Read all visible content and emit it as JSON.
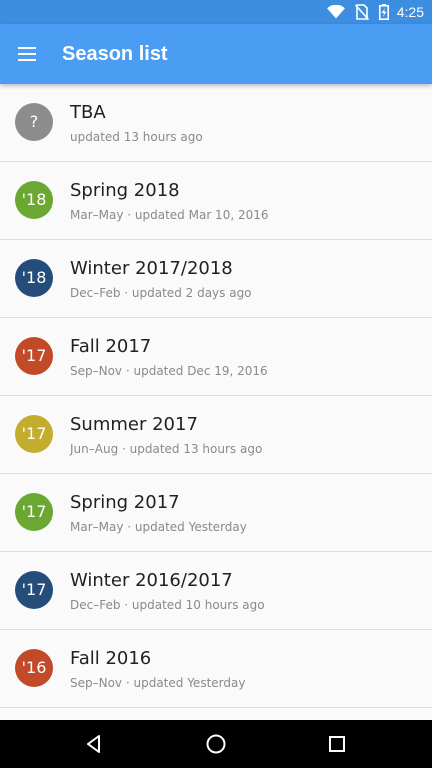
{
  "status_bar": {
    "time": "4:25",
    "icons": [
      "wifi-icon",
      "no-sim-icon",
      "battery-charging-icon"
    ]
  },
  "app_bar": {
    "title": "Season list",
    "menu_icon": "menu-icon"
  },
  "seasons": [
    {
      "badge": "?",
      "color": "#8c8c8c",
      "title": "TBA",
      "subtitle": "updated 13 hours ago"
    },
    {
      "badge": "'18",
      "color": "#6aa832",
      "title": "Spring 2018",
      "subtitle": "Mar–May · updated Mar 10, 2016"
    },
    {
      "badge": "'18",
      "color": "#244d7a",
      "title": "Winter 2017/2018",
      "subtitle": "Dec–Feb · updated 2 days ago"
    },
    {
      "badge": "'17",
      "color": "#c34a28",
      "title": "Fall 2017",
      "subtitle": "Sep–Nov · updated Dec 19, 2016"
    },
    {
      "badge": "'17",
      "color": "#c4ac2c",
      "title": "Summer 2017",
      "subtitle": "Jun–Aug · updated 13 hours ago"
    },
    {
      "badge": "'17",
      "color": "#6aa832",
      "title": "Spring 2017",
      "subtitle": "Mar–May · updated Yesterday"
    },
    {
      "badge": "'17",
      "color": "#244d7a",
      "title": "Winter 2016/2017",
      "subtitle": "Dec–Feb · updated 10 hours ago"
    },
    {
      "badge": "'16",
      "color": "#c34a28",
      "title": "Fall 2016",
      "subtitle": "Sep–Nov · updated Yesterday"
    },
    {
      "badge": "",
      "color": "#6aa832",
      "title": "",
      "subtitle": ""
    }
  ],
  "nav_bar": {
    "icons": [
      "back-icon",
      "home-icon",
      "recents-icon"
    ]
  },
  "colors": {
    "status_bar": "#3d8ee0",
    "app_bar": "#4a9df3",
    "list_background": "#fafafa",
    "divider": "#dedede",
    "title_text": "#212121",
    "subtitle_text": "#8a8a8a"
  }
}
